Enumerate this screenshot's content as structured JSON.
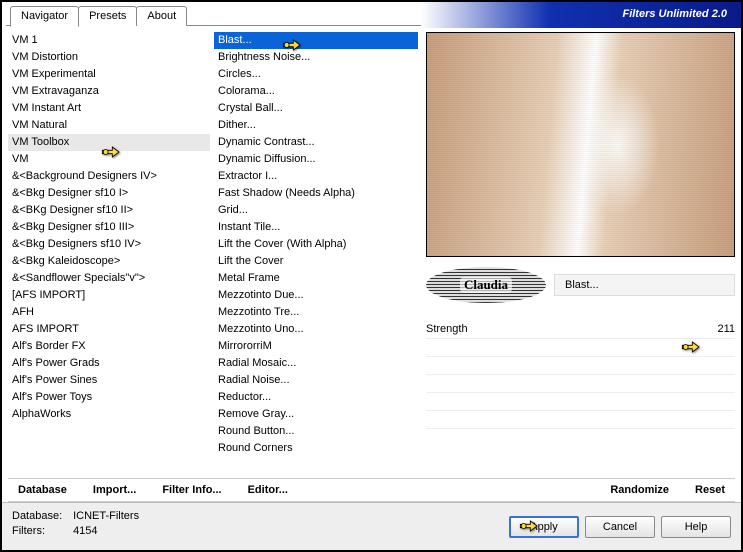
{
  "header": {
    "title": "Filters Unlimited 2.0"
  },
  "tabs": [
    {
      "label": "Navigator",
      "active": true
    },
    {
      "label": "Presets",
      "active": false
    },
    {
      "label": "About",
      "active": false
    }
  ],
  "categories": [
    "VM 1",
    "VM Distortion",
    "VM Experimental",
    "VM Extravaganza",
    "VM Instant Art",
    "VM Natural",
    "VM Toolbox",
    "VM",
    "&<Background Designers IV>",
    "&<Bkg Designer sf10 I>",
    "&<BKg Designer sf10 II>",
    "&<Bkg Designer sf10 III>",
    "&<Bkg Designers sf10 IV>",
    "&<Bkg Kaleidoscope>",
    "&<Sandflower Specials\"v\">",
    "[AFS IMPORT]",
    "AFH",
    "AFS IMPORT",
    "Alf's Border FX",
    "Alf's Power Grads",
    "Alf's Power Sines",
    "Alf's Power Toys",
    "AlphaWorks"
  ],
  "categories_selected_index": 6,
  "filters": [
    "Blast...",
    "Brightness Noise...",
    "Circles...",
    "Colorama...",
    "Crystal Ball...",
    "Dither...",
    "Dynamic Contrast...",
    "Dynamic Diffusion...",
    "Extractor I...",
    "Fast Shadow (Needs Alpha)",
    "Grid...",
    "Instant Tile...",
    "Lift the Cover (With Alpha)",
    "Lift the Cover",
    "Metal Frame",
    "Mezzotinto Due...",
    "Mezzotinto Tre...",
    "Mezzotinto Uno...",
    "MirrororriM",
    "Radial Mosaic...",
    "Radial Noise...",
    "Reductor...",
    "Remove Gray...",
    "Round Button...",
    "Round Corners"
  ],
  "filters_selected_index": 0,
  "effect": {
    "logo_text": "Claudia",
    "name": "Blast..."
  },
  "params": [
    {
      "label": "Strength",
      "value": "211"
    }
  ],
  "toolbar": {
    "database": "Database",
    "import": "Import...",
    "filter_info": "Filter Info...",
    "editor": "Editor...",
    "randomize": "Randomize",
    "reset": "Reset"
  },
  "status": {
    "db_label": "Database:",
    "db_value": "ICNET-Filters",
    "filters_label": "Filters:",
    "filters_value": "4154"
  },
  "buttons": {
    "apply": "Apply",
    "cancel": "Cancel",
    "help": "Help"
  }
}
